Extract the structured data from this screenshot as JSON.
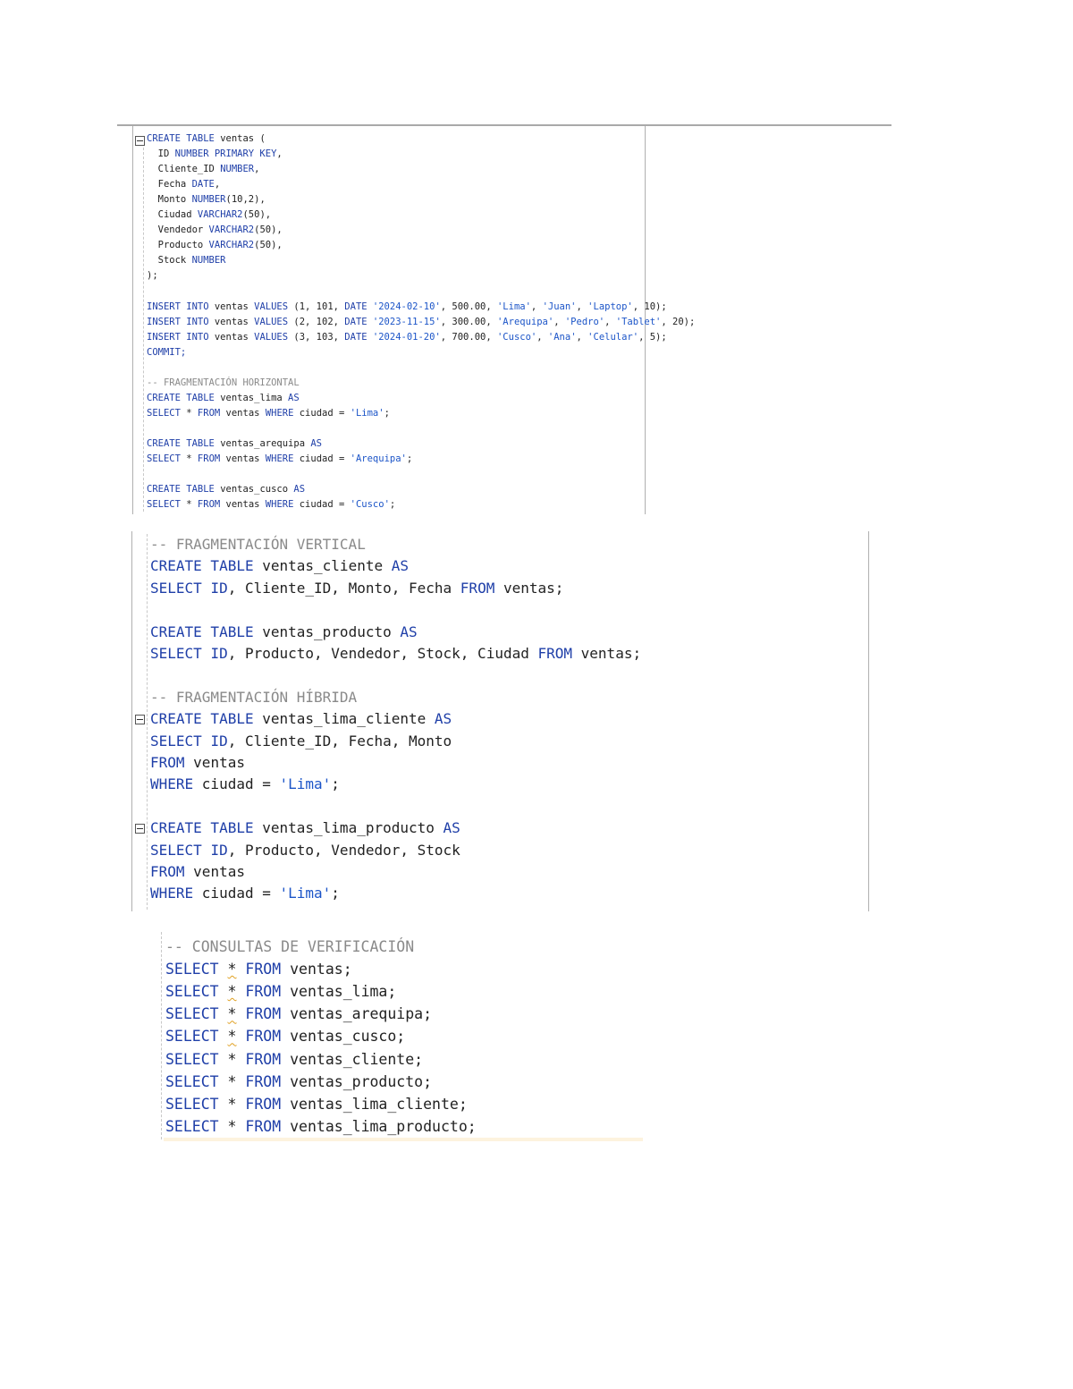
{
  "editor_top": {
    "lines": [
      [
        {
          "t": "CREATE TABLE ",
          "c": "kw"
        },
        {
          "t": "ventas (",
          "c": ""
        }
      ],
      [
        {
          "t": "  ID ",
          "c": ""
        },
        {
          "t": "NUMBER PRIMARY KEY",
          "c": "kw"
        },
        {
          "t": ",",
          "c": ""
        }
      ],
      [
        {
          "t": "  Cliente_ID ",
          "c": ""
        },
        {
          "t": "NUMBER",
          "c": "kw"
        },
        {
          "t": ",",
          "c": ""
        }
      ],
      [
        {
          "t": "  Fecha ",
          "c": ""
        },
        {
          "t": "DATE",
          "c": "kw"
        },
        {
          "t": ",",
          "c": ""
        }
      ],
      [
        {
          "t": "  Monto ",
          "c": ""
        },
        {
          "t": "NUMBER",
          "c": "kw"
        },
        {
          "t": "(10,2),",
          "c": ""
        }
      ],
      [
        {
          "t": "  Ciudad ",
          "c": ""
        },
        {
          "t": "VARCHAR2",
          "c": "kw"
        },
        {
          "t": "(50),",
          "c": ""
        }
      ],
      [
        {
          "t": "  Vendedor ",
          "c": ""
        },
        {
          "t": "VARCHAR2",
          "c": "kw"
        },
        {
          "t": "(50),",
          "c": ""
        }
      ],
      [
        {
          "t": "  Producto ",
          "c": ""
        },
        {
          "t": "VARCHAR2",
          "c": "kw"
        },
        {
          "t": "(50),",
          "c": ""
        }
      ],
      [
        {
          "t": "  Stock ",
          "c": ""
        },
        {
          "t": "NUMBER",
          "c": "kw"
        }
      ],
      [
        {
          "t": ");",
          "c": ""
        }
      ],
      [],
      [
        {
          "t": "INSERT INTO ",
          "c": "kw"
        },
        {
          "t": "ventas ",
          "c": ""
        },
        {
          "t": "VALUES ",
          "c": "kw"
        },
        {
          "t": "(1, 101, ",
          "c": ""
        },
        {
          "t": "DATE ",
          "c": "kw"
        },
        {
          "t": "'2024-02-10'",
          "c": "str"
        },
        {
          "t": ", 500.00, ",
          "c": ""
        },
        {
          "t": "'Lima'",
          "c": "str"
        },
        {
          "t": ", ",
          "c": ""
        },
        {
          "t": "'Juan'",
          "c": "str"
        },
        {
          "t": ", ",
          "c": ""
        },
        {
          "t": "'Laptop'",
          "c": "str"
        },
        {
          "t": ", 10);",
          "c": ""
        }
      ],
      [
        {
          "t": "INSERT INTO ",
          "c": "kw"
        },
        {
          "t": "ventas ",
          "c": ""
        },
        {
          "t": "VALUES ",
          "c": "kw"
        },
        {
          "t": "(2, 102, ",
          "c": ""
        },
        {
          "t": "DATE ",
          "c": "kw"
        },
        {
          "t": "'2023-11-15'",
          "c": "str"
        },
        {
          "t": ", 300.00, ",
          "c": ""
        },
        {
          "t": "'Arequipa'",
          "c": "str"
        },
        {
          "t": ", ",
          "c": ""
        },
        {
          "t": "'Pedro'",
          "c": "str"
        },
        {
          "t": ", ",
          "c": ""
        },
        {
          "t": "'Tablet'",
          "c": "str"
        },
        {
          "t": ", 20);",
          "c": ""
        }
      ],
      [
        {
          "t": "INSERT INTO ",
          "c": "kw"
        },
        {
          "t": "ventas ",
          "c": ""
        },
        {
          "t": "VALUES ",
          "c": "kw"
        },
        {
          "t": "(3, 103, ",
          "c": ""
        },
        {
          "t": "DATE ",
          "c": "kw"
        },
        {
          "t": "'2024-01-20'",
          "c": "str"
        },
        {
          "t": ", 700.00, ",
          "c": ""
        },
        {
          "t": "'Cusco'",
          "c": "str"
        },
        {
          "t": ", ",
          "c": ""
        },
        {
          "t": "'Ana'",
          "c": "str"
        },
        {
          "t": ", ",
          "c": ""
        },
        {
          "t": "'Celular'",
          "c": "str"
        },
        {
          "t": ", 5);",
          "c": ""
        }
      ],
      [
        {
          "t": "COMMIT;",
          "c": "kw"
        }
      ],
      [],
      [
        {
          "t": "-- FRAGMENTACIÓN HORIZONTAL",
          "c": "cm"
        }
      ],
      [
        {
          "t": "CREATE TABLE ",
          "c": "kw"
        },
        {
          "t": "ventas_lima ",
          "c": ""
        },
        {
          "t": "AS",
          "c": "kw"
        }
      ],
      [
        {
          "t": "SELECT ",
          "c": "kw"
        },
        {
          "t": "* ",
          "c": ""
        },
        {
          "t": "FROM ",
          "c": "kw"
        },
        {
          "t": "ventas ",
          "c": ""
        },
        {
          "t": "WHERE ",
          "c": "kw"
        },
        {
          "t": "ciudad = ",
          "c": ""
        },
        {
          "t": "'Lima'",
          "c": "str"
        },
        {
          "t": ";",
          "c": ""
        }
      ],
      [],
      [
        {
          "t": "CREATE TABLE ",
          "c": "kw"
        },
        {
          "t": "ventas_arequipa ",
          "c": ""
        },
        {
          "t": "AS",
          "c": "kw"
        }
      ],
      [
        {
          "t": "SELECT ",
          "c": "kw"
        },
        {
          "t": "* ",
          "c": ""
        },
        {
          "t": "FROM ",
          "c": "kw"
        },
        {
          "t": "ventas ",
          "c": ""
        },
        {
          "t": "WHERE ",
          "c": "kw"
        },
        {
          "t": "ciudad = ",
          "c": ""
        },
        {
          "t": "'Arequipa'",
          "c": "str"
        },
        {
          "t": ";",
          "c": ""
        }
      ],
      [],
      [
        {
          "t": "CREATE TABLE ",
          "c": "kw"
        },
        {
          "t": "ventas_cusco ",
          "c": ""
        },
        {
          "t": "AS",
          "c": "kw"
        }
      ],
      [
        {
          "t": "SELECT ",
          "c": "kw"
        },
        {
          "t": "* ",
          "c": ""
        },
        {
          "t": "FROM ",
          "c": "kw"
        },
        {
          "t": "ventas ",
          "c": ""
        },
        {
          "t": "WHERE ",
          "c": "kw"
        },
        {
          "t": "ciudad = ",
          "c": ""
        },
        {
          "t": "'Cusco'",
          "c": "str"
        },
        {
          "t": ";",
          "c": ""
        }
      ]
    ]
  },
  "editor_middle": {
    "lines": [
      [
        {
          "t": "-- FRAGMENTACIÓN VERTICAL",
          "c": "cm"
        }
      ],
      [
        {
          "t": "CREATE TABLE ",
          "c": "kw"
        },
        {
          "t": "ventas_cliente ",
          "c": ""
        },
        {
          "t": "AS",
          "c": "kw"
        }
      ],
      [
        {
          "t": "SELECT ",
          "c": "kw"
        },
        {
          "t": "ID",
          "c": "kw"
        },
        {
          "t": ", Cliente_ID, Monto, Fecha ",
          "c": ""
        },
        {
          "t": "FROM ",
          "c": "kw"
        },
        {
          "t": "ventas;",
          "c": ""
        }
      ],
      [],
      [
        {
          "t": "CREATE TABLE ",
          "c": "kw"
        },
        {
          "t": "ventas_producto ",
          "c": ""
        },
        {
          "t": "AS",
          "c": "kw"
        }
      ],
      [
        {
          "t": "SELECT ",
          "c": "kw"
        },
        {
          "t": "ID",
          "c": "kw"
        },
        {
          "t": ", Producto, Vendedor, Stock, Ciudad ",
          "c": ""
        },
        {
          "t": "FROM ",
          "c": "kw"
        },
        {
          "t": "ventas;",
          "c": ""
        }
      ],
      [],
      [
        {
          "t": "-- FRAGMENTACIÓN HÍBRIDA",
          "c": "cm"
        }
      ],
      [
        {
          "t": "CREATE TABLE ",
          "c": "kw"
        },
        {
          "t": "ventas_lima_cliente ",
          "c": ""
        },
        {
          "t": "AS",
          "c": "kw"
        }
      ],
      [
        {
          "t": "SELECT ",
          "c": "kw"
        },
        {
          "t": "ID",
          "c": "kw"
        },
        {
          "t": ", Cliente_ID, Fecha, Monto",
          "c": ""
        }
      ],
      [
        {
          "t": "FROM ",
          "c": "kw"
        },
        {
          "t": "ventas",
          "c": ""
        }
      ],
      [
        {
          "t": "WHERE ",
          "c": "kw"
        },
        {
          "t": "ciudad = ",
          "c": ""
        },
        {
          "t": "'Lima'",
          "c": "str"
        },
        {
          "t": ";",
          "c": ""
        }
      ],
      [],
      [
        {
          "t": "CREATE TABLE ",
          "c": "kw"
        },
        {
          "t": "ventas_lima_producto ",
          "c": ""
        },
        {
          "t": "AS",
          "c": "kw"
        }
      ],
      [
        {
          "t": "SELECT ",
          "c": "kw"
        },
        {
          "t": "ID",
          "c": "kw"
        },
        {
          "t": ", Producto, Vendedor, Stock",
          "c": ""
        }
      ],
      [
        {
          "t": "FROM ",
          "c": "kw"
        },
        {
          "t": "ventas",
          "c": ""
        }
      ],
      [
        {
          "t": "WHERE ",
          "c": "kw"
        },
        {
          "t": "ciudad = ",
          "c": ""
        },
        {
          "t": "'Lima'",
          "c": "str"
        },
        {
          "t": ";",
          "c": ""
        }
      ]
    ]
  },
  "editor_bottom": {
    "lines": [
      [
        {
          "t": "-- CONSULTAS DE VERIFICACIÓN",
          "c": "cm"
        }
      ],
      [
        {
          "t": "SELECT ",
          "c": "kw"
        },
        {
          "t": "*",
          "c": "squig"
        },
        {
          "t": " ",
          "c": ""
        },
        {
          "t": "FROM ",
          "c": "kw"
        },
        {
          "t": "ventas;",
          "c": ""
        }
      ],
      [
        {
          "t": "SELECT ",
          "c": "kw"
        },
        {
          "t": "*",
          "c": "squig"
        },
        {
          "t": " ",
          "c": ""
        },
        {
          "t": "FROM ",
          "c": "kw"
        },
        {
          "t": "ventas_lima;",
          "c": ""
        }
      ],
      [
        {
          "t": "SELECT ",
          "c": "kw"
        },
        {
          "t": "*",
          "c": "squig"
        },
        {
          "t": " ",
          "c": ""
        },
        {
          "t": "FROM ",
          "c": "kw"
        },
        {
          "t": "ventas_arequipa;",
          "c": ""
        }
      ],
      [
        {
          "t": "SELECT ",
          "c": "kw"
        },
        {
          "t": "*",
          "c": "squig"
        },
        {
          "t": " ",
          "c": ""
        },
        {
          "t": "FROM ",
          "c": "kw"
        },
        {
          "t": "ventas_cusco;",
          "c": ""
        }
      ],
      [
        {
          "t": "SELECT ",
          "c": "kw"
        },
        {
          "t": "* ",
          "c": ""
        },
        {
          "t": "FROM ",
          "c": "kw"
        },
        {
          "t": "ventas_cliente;",
          "c": ""
        }
      ],
      [
        {
          "t": "SELECT ",
          "c": "kw"
        },
        {
          "t": "* ",
          "c": ""
        },
        {
          "t": "FROM ",
          "c": "kw"
        },
        {
          "t": "ventas_producto;",
          "c": ""
        }
      ],
      [
        {
          "t": "SELECT ",
          "c": "kw"
        },
        {
          "t": "* ",
          "c": ""
        },
        {
          "t": "FROM ",
          "c": "kw"
        },
        {
          "t": "ventas_lima_cliente;",
          "c": ""
        }
      ],
      [
        {
          "t": "SELECT ",
          "c": "kw"
        },
        {
          "t": "* ",
          "c": ""
        },
        {
          "t": "FROM ",
          "c": "kw"
        },
        {
          "t": "ventas_lima_producto;",
          "c": ""
        }
      ]
    ]
  },
  "colors": {
    "keyword": "#1f3fa8",
    "string": "#1c55c8",
    "comment": "#8a8a8a",
    "text": "#222222"
  }
}
